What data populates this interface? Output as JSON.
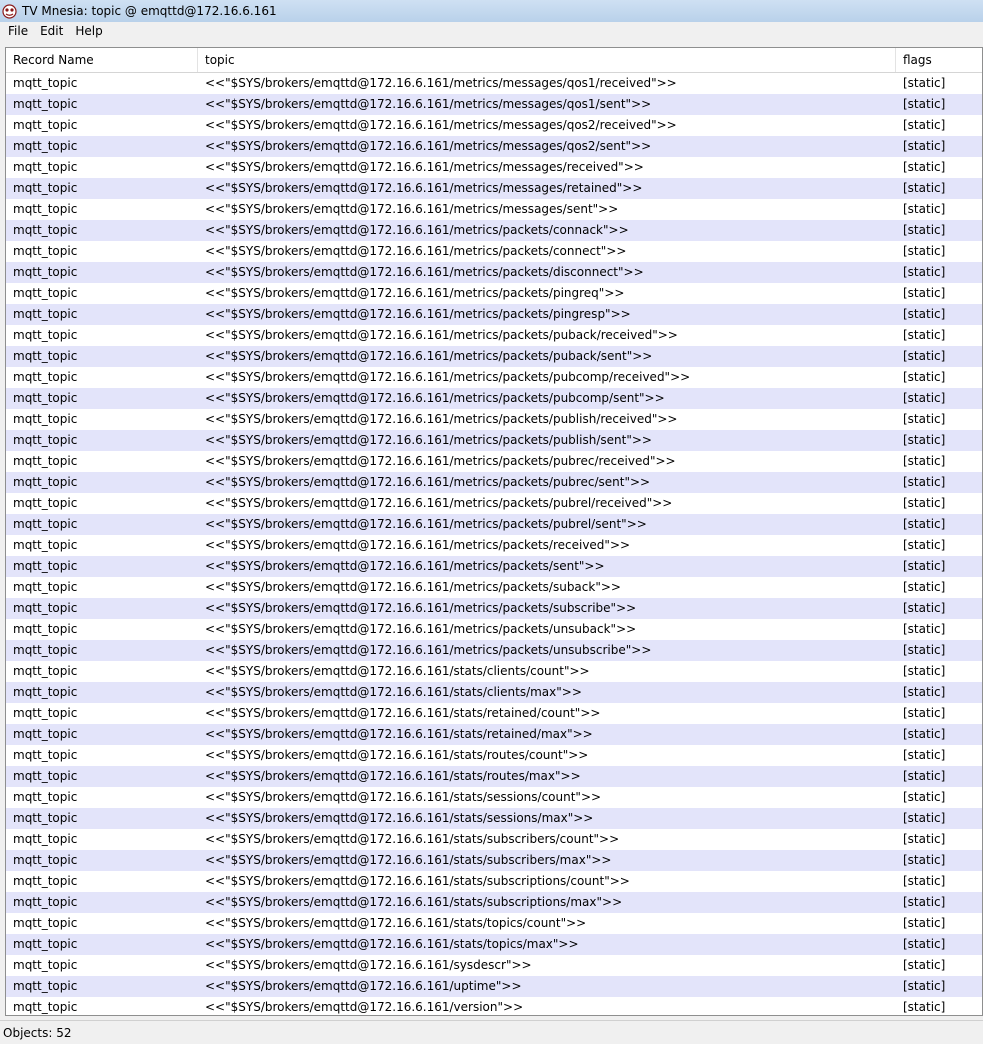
{
  "window": {
    "title": "TV Mnesia: topic @ emqttd@172.16.6.161"
  },
  "menu": {
    "items": [
      "File",
      "Edit",
      "Help"
    ]
  },
  "table": {
    "columns": [
      "Record Name",
      "topic",
      "flags"
    ],
    "rows": [
      [
        "mqtt_topic",
        "<<\"$SYS/brokers/emqttd@172.16.6.161/metrics/messages/qos1/received\">>",
        "[static]"
      ],
      [
        "mqtt_topic",
        "<<\"$SYS/brokers/emqttd@172.16.6.161/metrics/messages/qos1/sent\">>",
        "[static]"
      ],
      [
        "mqtt_topic",
        "<<\"$SYS/brokers/emqttd@172.16.6.161/metrics/messages/qos2/received\">>",
        "[static]"
      ],
      [
        "mqtt_topic",
        "<<\"$SYS/brokers/emqttd@172.16.6.161/metrics/messages/qos2/sent\">>",
        "[static]"
      ],
      [
        "mqtt_topic",
        "<<\"$SYS/brokers/emqttd@172.16.6.161/metrics/messages/received\">>",
        "[static]"
      ],
      [
        "mqtt_topic",
        "<<\"$SYS/brokers/emqttd@172.16.6.161/metrics/messages/retained\">>",
        "[static]"
      ],
      [
        "mqtt_topic",
        "<<\"$SYS/brokers/emqttd@172.16.6.161/metrics/messages/sent\">>",
        "[static]"
      ],
      [
        "mqtt_topic",
        "<<\"$SYS/brokers/emqttd@172.16.6.161/metrics/packets/connack\">>",
        "[static]"
      ],
      [
        "mqtt_topic",
        "<<\"$SYS/brokers/emqttd@172.16.6.161/metrics/packets/connect\">>",
        "[static]"
      ],
      [
        "mqtt_topic",
        "<<\"$SYS/brokers/emqttd@172.16.6.161/metrics/packets/disconnect\">>",
        "[static]"
      ],
      [
        "mqtt_topic",
        "<<\"$SYS/brokers/emqttd@172.16.6.161/metrics/packets/pingreq\">>",
        "[static]"
      ],
      [
        "mqtt_topic",
        "<<\"$SYS/brokers/emqttd@172.16.6.161/metrics/packets/pingresp\">>",
        "[static]"
      ],
      [
        "mqtt_topic",
        "<<\"$SYS/brokers/emqttd@172.16.6.161/metrics/packets/puback/received\">>",
        "[static]"
      ],
      [
        "mqtt_topic",
        "<<\"$SYS/brokers/emqttd@172.16.6.161/metrics/packets/puback/sent\">>",
        "[static]"
      ],
      [
        "mqtt_topic",
        "<<\"$SYS/brokers/emqttd@172.16.6.161/metrics/packets/pubcomp/received\">>",
        "[static]"
      ],
      [
        "mqtt_topic",
        "<<\"$SYS/brokers/emqttd@172.16.6.161/metrics/packets/pubcomp/sent\">>",
        "[static]"
      ],
      [
        "mqtt_topic",
        "<<\"$SYS/brokers/emqttd@172.16.6.161/metrics/packets/publish/received\">>",
        "[static]"
      ],
      [
        "mqtt_topic",
        "<<\"$SYS/brokers/emqttd@172.16.6.161/metrics/packets/publish/sent\">>",
        "[static]"
      ],
      [
        "mqtt_topic",
        "<<\"$SYS/brokers/emqttd@172.16.6.161/metrics/packets/pubrec/received\">>",
        "[static]"
      ],
      [
        "mqtt_topic",
        "<<\"$SYS/brokers/emqttd@172.16.6.161/metrics/packets/pubrec/sent\">>",
        "[static]"
      ],
      [
        "mqtt_topic",
        "<<\"$SYS/brokers/emqttd@172.16.6.161/metrics/packets/pubrel/received\">>",
        "[static]"
      ],
      [
        "mqtt_topic",
        "<<\"$SYS/brokers/emqttd@172.16.6.161/metrics/packets/pubrel/sent\">>",
        "[static]"
      ],
      [
        "mqtt_topic",
        "<<\"$SYS/brokers/emqttd@172.16.6.161/metrics/packets/received\">>",
        "[static]"
      ],
      [
        "mqtt_topic",
        "<<\"$SYS/brokers/emqttd@172.16.6.161/metrics/packets/sent\">>",
        "[static]"
      ],
      [
        "mqtt_topic",
        "<<\"$SYS/brokers/emqttd@172.16.6.161/metrics/packets/suback\">>",
        "[static]"
      ],
      [
        "mqtt_topic",
        "<<\"$SYS/brokers/emqttd@172.16.6.161/metrics/packets/subscribe\">>",
        "[static]"
      ],
      [
        "mqtt_topic",
        "<<\"$SYS/brokers/emqttd@172.16.6.161/metrics/packets/unsuback\">>",
        "[static]"
      ],
      [
        "mqtt_topic",
        "<<\"$SYS/brokers/emqttd@172.16.6.161/metrics/packets/unsubscribe\">>",
        "[static]"
      ],
      [
        "mqtt_topic",
        "<<\"$SYS/brokers/emqttd@172.16.6.161/stats/clients/count\">>",
        "[static]"
      ],
      [
        "mqtt_topic",
        "<<\"$SYS/brokers/emqttd@172.16.6.161/stats/clients/max\">>",
        "[static]"
      ],
      [
        "mqtt_topic",
        "<<\"$SYS/brokers/emqttd@172.16.6.161/stats/retained/count\">>",
        "[static]"
      ],
      [
        "mqtt_topic",
        "<<\"$SYS/brokers/emqttd@172.16.6.161/stats/retained/max\">>",
        "[static]"
      ],
      [
        "mqtt_topic",
        "<<\"$SYS/brokers/emqttd@172.16.6.161/stats/routes/count\">>",
        "[static]"
      ],
      [
        "mqtt_topic",
        "<<\"$SYS/brokers/emqttd@172.16.6.161/stats/routes/max\">>",
        "[static]"
      ],
      [
        "mqtt_topic",
        "<<\"$SYS/brokers/emqttd@172.16.6.161/stats/sessions/count\">>",
        "[static]"
      ],
      [
        "mqtt_topic",
        "<<\"$SYS/brokers/emqttd@172.16.6.161/stats/sessions/max\">>",
        "[static]"
      ],
      [
        "mqtt_topic",
        "<<\"$SYS/brokers/emqttd@172.16.6.161/stats/subscribers/count\">>",
        "[static]"
      ],
      [
        "mqtt_topic",
        "<<\"$SYS/brokers/emqttd@172.16.6.161/stats/subscribers/max\">>",
        "[static]"
      ],
      [
        "mqtt_topic",
        "<<\"$SYS/brokers/emqttd@172.16.6.161/stats/subscriptions/count\">>",
        "[static]"
      ],
      [
        "mqtt_topic",
        "<<\"$SYS/brokers/emqttd@172.16.6.161/stats/subscriptions/max\">>",
        "[static]"
      ],
      [
        "mqtt_topic",
        "<<\"$SYS/brokers/emqttd@172.16.6.161/stats/topics/count\">>",
        "[static]"
      ],
      [
        "mqtt_topic",
        "<<\"$SYS/brokers/emqttd@172.16.6.161/stats/topics/max\">>",
        "[static]"
      ],
      [
        "mqtt_topic",
        "<<\"$SYS/brokers/emqttd@172.16.6.161/sysdescr\">>",
        "[static]"
      ],
      [
        "mqtt_topic",
        "<<\"$SYS/brokers/emqttd@172.16.6.161/uptime\">>",
        "[static]"
      ],
      [
        "mqtt_topic",
        "<<\"$SYS/brokers/emqttd@172.16.6.161/version\">>",
        "[static]"
      ]
    ]
  },
  "status": {
    "text": "Objects: 52"
  },
  "colors": {
    "row_alt": "#e3e4fa",
    "row": "#ffffff"
  }
}
